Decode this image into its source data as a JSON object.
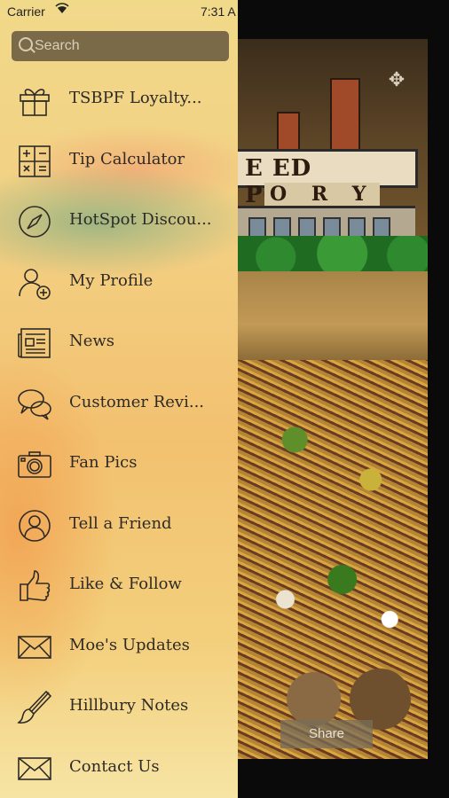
{
  "status_bar": {
    "carrier": "Carrier",
    "time": "7:31 A"
  },
  "search": {
    "placeholder": "Search"
  },
  "menu": {
    "items": [
      {
        "label": "TSBPF Loyalty...",
        "icon": "gift-icon"
      },
      {
        "label": "Tip Calculator",
        "icon": "calculator-icon"
      },
      {
        "label": "HotSpot Discou...",
        "icon": "compass-icon"
      },
      {
        "label": "My Profile",
        "icon": "add-user-icon"
      },
      {
        "label": "News",
        "icon": "newspaper-icon"
      },
      {
        "label": "Customer Revi...",
        "icon": "chat-bubbles-icon"
      },
      {
        "label": "Fan Pics",
        "icon": "camera-icon"
      },
      {
        "label": "Tell a Friend",
        "icon": "person-circle-icon"
      },
      {
        "label": "Like & Follow",
        "icon": "thumbs-up-icon"
      },
      {
        "label": "Moe's Updates",
        "icon": "envelope-icon"
      },
      {
        "label": "Hillbury Notes",
        "icon": "paintbrush-icon"
      },
      {
        "label": "Contact Us",
        "icon": "envelope-icon"
      }
    ]
  },
  "background": {
    "logo_line1": "E   ED POTATO",
    "logo_line2": "O R Y",
    "share_label": "Share"
  }
}
